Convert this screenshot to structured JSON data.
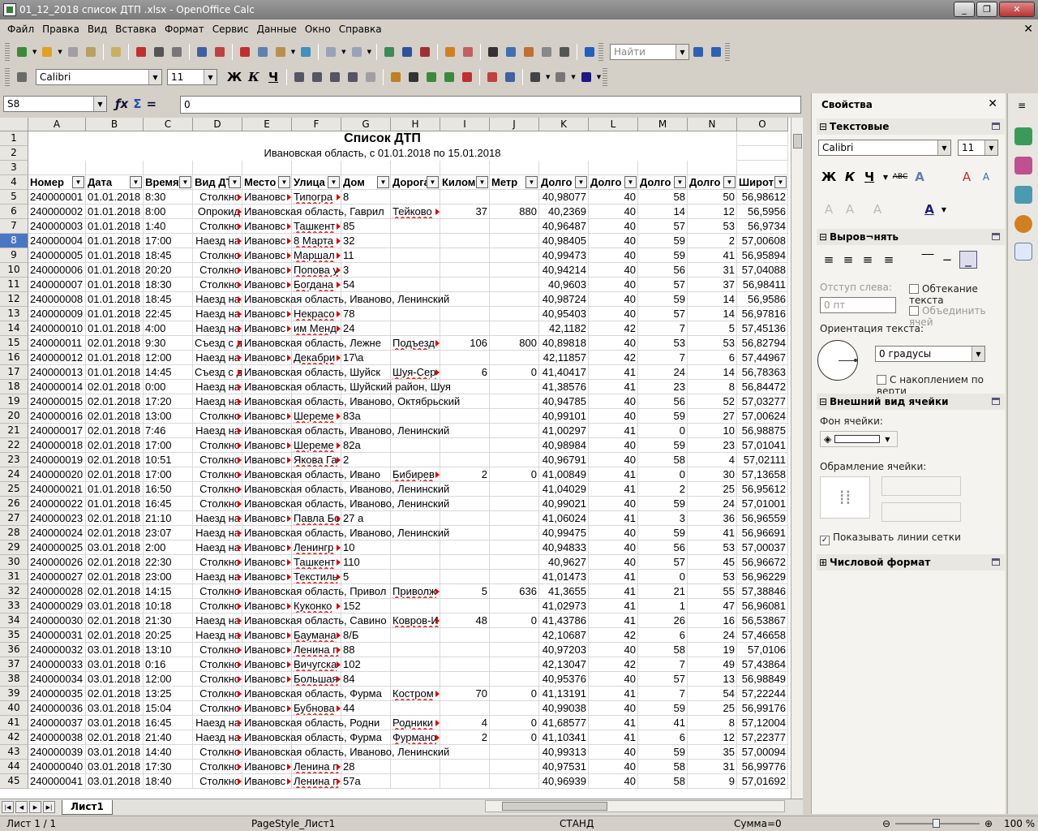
{
  "window": {
    "title": "01_12_2018 список ДТП .xlsx - OpenOffice Calc",
    "min": "_",
    "max": "❐",
    "close": "✕"
  },
  "menu": [
    "Файл",
    "Правка",
    "Вид",
    "Вставка",
    "Формат",
    "Сервис",
    "Данные",
    "Окно",
    "Справка"
  ],
  "menu_close": "✕",
  "toolbar": {
    "find_placeholder": "Найти"
  },
  "format_bar": {
    "font": "Calibri",
    "size": "11",
    "bold": "Ж",
    "italic": "К",
    "underline": "Ч"
  },
  "formula_bar": {
    "cell_ref": "S8",
    "value": "0"
  },
  "sheet": {
    "columns": [
      "A",
      "B",
      "C",
      "D",
      "E",
      "F",
      "G",
      "H",
      "I",
      "J",
      "K",
      "L",
      "M",
      "N",
      "O"
    ],
    "title": "Список ДТП",
    "subtitle": "Ивановская область, с 01.01.2018 по 15.01.2018",
    "headers": [
      "Номер",
      "Дата",
      "Время",
      "Вид ДТ",
      "Место",
      "Улица",
      "Дом",
      "Дорога",
      "Килом",
      "Метр",
      "Долго",
      "Долго",
      "Долго",
      "Долго",
      "Широт"
    ],
    "selected_row": "8",
    "rows": [
      [
        "5",
        "240000001",
        "01.01.2018",
        "8:30",
        "Столкно",
        "Ивановс",
        "Типогра",
        "8",
        "",
        "",
        "",
        "40,98077",
        "40",
        "58",
        "50",
        "56,98612"
      ],
      [
        "6",
        "240000002",
        "01.01.2018",
        "8:00",
        "Опрокид",
        "Ивановская область, Гаврил",
        "",
        "",
        "Тейково",
        "37",
        "880",
        "40,2369",
        "40",
        "14",
        "12",
        "56,5956"
      ],
      [
        "7",
        "240000003",
        "01.01.2018",
        "1:40",
        "Столкно",
        "Ивановс",
        "Ташкент",
        "85",
        "",
        "",
        "",
        "40,96487",
        "40",
        "57",
        "53",
        "56,9734"
      ],
      [
        "8",
        "240000004",
        "01.01.2018",
        "17:00",
        "Наезд на",
        "Ивановс",
        "8 Марта",
        "32",
        "",
        "",
        "",
        "40,98405",
        "40",
        "59",
        "2",
        "57,00608"
      ],
      [
        "9",
        "240000005",
        "01.01.2018",
        "18:45",
        "Столкно",
        "Ивановс",
        "Маршал",
        "11",
        "",
        "",
        "",
        "40,99473",
        "40",
        "59",
        "41",
        "56,95894"
      ],
      [
        "10",
        "240000006",
        "01.01.2018",
        "20:20",
        "Столкно",
        "Ивановс",
        "Попова у",
        "3",
        "",
        "",
        "",
        "40,94214",
        "40",
        "56",
        "31",
        "57,04088"
      ],
      [
        "11",
        "240000007",
        "01.01.2018",
        "18:30",
        "Столкно",
        "Ивановс",
        "Богдана",
        "54",
        "",
        "",
        "",
        "40,9603",
        "40",
        "57",
        "37",
        "56,98411"
      ],
      [
        "12",
        "240000008",
        "01.01.2018",
        "18:45",
        "Наезд на",
        "Ивановская область, Иваново, Ленинский",
        "",
        "",
        "",
        "",
        "",
        "40,98724",
        "40",
        "59",
        "14",
        "56,9586"
      ],
      [
        "13",
        "240000009",
        "01.01.2018",
        "22:45",
        "Наезд на",
        "Ивановс",
        "Некрасо",
        "78",
        "",
        "",
        "",
        "40,95403",
        "40",
        "57",
        "14",
        "56,97816"
      ],
      [
        "14",
        "240000010",
        "01.01.2018",
        "4:00",
        "Наезд на",
        "Ивановс",
        "им Менд",
        "24",
        "",
        "",
        "",
        "42,1182",
        "42",
        "7",
        "5",
        "57,45136"
      ],
      [
        "15",
        "240000011",
        "02.01.2018",
        "9:30",
        "Съезд с д",
        "Ивановская область, Лежне",
        "",
        "",
        "Подъезд",
        "106",
        "800",
        "40,89818",
        "40",
        "53",
        "53",
        "56,82794"
      ],
      [
        "16",
        "240000012",
        "01.01.2018",
        "12:00",
        "Наезд на",
        "Ивановс",
        "Декабри",
        "17\\а",
        "",
        "",
        "",
        "42,11857",
        "42",
        "7",
        "6",
        "57,44967"
      ],
      [
        "17",
        "240000013",
        "01.01.2018",
        "14:45",
        "Съезд с д",
        "Ивановская область, Шуйск",
        "",
        "",
        "Шуя-Сер",
        "6",
        "0",
        "41,40417",
        "41",
        "24",
        "14",
        "56,78363"
      ],
      [
        "18",
        "240000014",
        "02.01.2018",
        "0:00",
        "Наезд на",
        "Ивановская область, Шуйский район, Шуя",
        "",
        "",
        "",
        "",
        "",
        "41,38576",
        "41",
        "23",
        "8",
        "56,84472"
      ],
      [
        "19",
        "240000015",
        "02.01.2018",
        "17:20",
        "Наезд на",
        "Ивановская область, Иваново, Октябрьский",
        "",
        "",
        "",
        "",
        "",
        "40,94785",
        "40",
        "56",
        "52",
        "57,03277"
      ],
      [
        "20",
        "240000016",
        "02.01.2018",
        "13:00",
        "Столкно",
        "Ивановс",
        "Шереме",
        "83а",
        "",
        "",
        "",
        "40,99101",
        "40",
        "59",
        "27",
        "57,00624"
      ],
      [
        "21",
        "240000017",
        "02.01.2018",
        "7:46",
        "Наезд на",
        "Ивановская область, Иваново, Ленинский",
        "",
        "",
        "",
        "",
        "",
        "41,00297",
        "41",
        "0",
        "10",
        "56,98875"
      ],
      [
        "22",
        "240000018",
        "02.01.2018",
        "17:00",
        "Столкно",
        "Ивановс",
        "Шереме",
        "82а",
        "",
        "",
        "",
        "40,98984",
        "40",
        "59",
        "23",
        "57,01041"
      ],
      [
        "23",
        "240000019",
        "02.01.2018",
        "10:51",
        "Столкно",
        "Ивановс",
        "Якова Га",
        "2",
        "",
        "",
        "",
        "40,96791",
        "40",
        "58",
        "4",
        "57,02111"
      ],
      [
        "24",
        "240000020",
        "02.01.2018",
        "17:00",
        "Столкно",
        "Ивановская область, Ивано",
        "",
        "",
        "Бибирев",
        "2",
        "0",
        "41,00849",
        "41",
        "0",
        "30",
        "57,13658"
      ],
      [
        "25",
        "240000021",
        "01.01.2018",
        "16:50",
        "Столкно",
        "Ивановская область, Иваново, Ленинский",
        "",
        "",
        "",
        "",
        "",
        "41,04029",
        "41",
        "2",
        "25",
        "56,95612"
      ],
      [
        "26",
        "240000022",
        "01.01.2018",
        "16:45",
        "Столкно",
        "Ивановская область, Иваново, Ленинский",
        "",
        "",
        "",
        "",
        "",
        "40,99021",
        "40",
        "59",
        "24",
        "57,01001"
      ],
      [
        "27",
        "240000023",
        "02.01.2018",
        "21:10",
        "Наезд на",
        "Ивановс",
        "Павла Бо",
        "27 а",
        "",
        "",
        "",
        "41,06024",
        "41",
        "3",
        "36",
        "56,96559"
      ],
      [
        "28",
        "240000024",
        "02.01.2018",
        "23:07",
        "Наезд на",
        "Ивановская область, Иваново, Ленинский",
        "",
        "",
        "",
        "",
        "",
        "40,99475",
        "40",
        "59",
        "41",
        "56,96691"
      ],
      [
        "29",
        "240000025",
        "03.01.2018",
        "2:00",
        "Наезд на",
        "Ивановс",
        "Ленингр",
        "10",
        "",
        "",
        "",
        "40,94833",
        "40",
        "56",
        "53",
        "57,00037"
      ],
      [
        "30",
        "240000026",
        "02.01.2018",
        "22:30",
        "Столкно",
        "Ивановс",
        "Ташкент",
        "110",
        "",
        "",
        "",
        "40,9627",
        "40",
        "57",
        "45",
        "56,96672"
      ],
      [
        "31",
        "240000027",
        "02.01.2018",
        "23:00",
        "Наезд на",
        "Ивановс",
        "Текстиль",
        "5",
        "",
        "",
        "",
        "41,01473",
        "41",
        "0",
        "53",
        "56,96229"
      ],
      [
        "32",
        "240000028",
        "02.01.2018",
        "14:15",
        "Столкно",
        "Ивановская область, Привол",
        "",
        "",
        "Приволж",
        "5",
        "636",
        "41,3655",
        "41",
        "21",
        "55",
        "57,38846"
      ],
      [
        "33",
        "240000029",
        "03.01.2018",
        "10:18",
        "Столкно",
        "Ивановс",
        "Куконко",
        "152",
        "",
        "",
        "",
        "41,02973",
        "41",
        "1",
        "47",
        "56,96081"
      ],
      [
        "34",
        "240000030",
        "02.01.2018",
        "21:30",
        "Наезд на",
        "Ивановская область, Савино",
        "",
        "",
        "Ковров-И",
        "48",
        "0",
        "41,43786",
        "41",
        "26",
        "16",
        "56,53867"
      ],
      [
        "35",
        "240000031",
        "02.01.2018",
        "20:25",
        "Наезд на",
        "Ивановс",
        "Баумана",
        "8/Б",
        "",
        "",
        "",
        "42,10687",
        "42",
        "6",
        "24",
        "57,46658"
      ],
      [
        "36",
        "240000032",
        "03.01.2018",
        "13:10",
        "Столкно",
        "Ивановс",
        "Ленина п",
        "88",
        "",
        "",
        "",
        "40,97203",
        "40",
        "58",
        "19",
        "57,0106"
      ],
      [
        "37",
        "240000033",
        "03.01.2018",
        "0:16",
        "Столкно",
        "Ивановс",
        "Вичугска",
        "102",
        "",
        "",
        "",
        "42,13047",
        "42",
        "7",
        "49",
        "57,43864"
      ],
      [
        "38",
        "240000034",
        "03.01.2018",
        "12:00",
        "Столкно",
        "Ивановс",
        "Большая",
        "84",
        "",
        "",
        "",
        "40,95376",
        "40",
        "57",
        "13",
        "56,98849"
      ],
      [
        "39",
        "240000035",
        "02.01.2018",
        "13:25",
        "Столкно",
        "Ивановская область, Фурма",
        "",
        "",
        "Костром",
        "70",
        "0",
        "41,13191",
        "41",
        "7",
        "54",
        "57,22244"
      ],
      [
        "40",
        "240000036",
        "03.01.2018",
        "15:04",
        "Столкно",
        "Ивановс",
        "Бубнова",
        "44",
        "",
        "",
        "",
        "40,99038",
        "40",
        "59",
        "25",
        "56,99176"
      ],
      [
        "41",
        "240000037",
        "03.01.2018",
        "16:45",
        "Наезд на",
        "Ивановская область, Родни",
        "",
        "",
        "Родники",
        "4",
        "0",
        "41,68577",
        "41",
        "41",
        "8",
        "57,12004"
      ],
      [
        "42",
        "240000038",
        "02.01.2018",
        "21:40",
        "Наезд на",
        "Ивановская область, Фурма",
        "",
        "",
        "Фурмано",
        "2",
        "0",
        "41,10341",
        "41",
        "6",
        "12",
        "57,22377"
      ],
      [
        "43",
        "240000039",
        "03.01.2018",
        "14:40",
        "Столкно",
        "Ивановская область, Иваново, Ленинский",
        "",
        "",
        "",
        "",
        "",
        "40,99313",
        "40",
        "59",
        "35",
        "57,00094"
      ],
      [
        "44",
        "240000040",
        "03.01.2018",
        "17:30",
        "Столкно",
        "Ивановс",
        "Ленина п",
        "28",
        "",
        "",
        "",
        "40,97531",
        "40",
        "58",
        "31",
        "56,99776"
      ],
      [
        "45",
        "240000041",
        "03.01.2018",
        "18:40",
        "Столкно",
        "Ивановс",
        "Ленина п",
        "57а",
        "",
        "",
        "",
        "40,96939",
        "40",
        "58",
        "9",
        "57,01692"
      ]
    ],
    "tab": "Лист1"
  },
  "status": {
    "page": "Лист 1 / 1",
    "style": "PageStyle_Лист1",
    "mode": "СТАНД",
    "sum": "Сумма=0",
    "zoom": "100 %"
  },
  "sidebar": {
    "title": "Свойства",
    "sec_text": "Текстовые",
    "font": "Calibri",
    "size": "11",
    "sec_align": "Выров¬нять",
    "indent_label": "Отступ слева:",
    "indent_value": "0 пт",
    "wrap": "Обтекание текста",
    "merge": "Объединить ячей",
    "orient_label": "Ориентация текста:",
    "orient_value": "0 градусы",
    "stacked": "С накоплением по верти",
    "sec_appearance": "Внешний вид ячейки",
    "bg_label": "Фон ячейки:",
    "border_label": "Обрамление ячейки:",
    "gridlines": "Показывать линии сетки",
    "sec_number": "Числовой формат"
  }
}
